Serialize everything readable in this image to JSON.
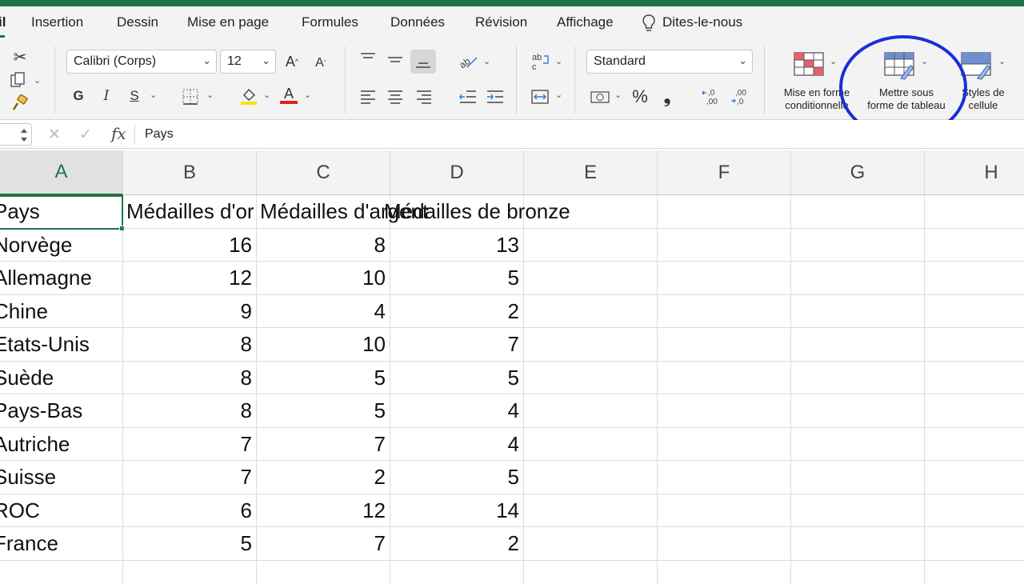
{
  "tabs": [
    "il",
    "Insertion",
    "Dessin",
    "Mise en page",
    "Formules",
    "Données",
    "Révision",
    "Affichage",
    "Dites-le-nous"
  ],
  "ribbon": {
    "font_name": "Calibri (Corps)",
    "font_size": "12",
    "bold": "G",
    "italic": "I",
    "underline": "S",
    "number_format": "Standard",
    "percent": "%",
    "comma": "❟",
    "cond_format_l1": "Mise en forme",
    "cond_format_l2": "conditionnelle",
    "format_table_l1": "Mettre sous",
    "format_table_l2": "forme de tableau",
    "cell_styles_l1": "Styles de",
    "cell_styles_l2": "cellule"
  },
  "formula_bar": {
    "fx": "fx",
    "value": "Pays"
  },
  "columns": [
    "A",
    "B",
    "C",
    "D",
    "E",
    "F",
    "G",
    "H"
  ],
  "rows": [
    [
      "Pays",
      "Médailles d'or",
      "Médailles d'argent",
      "Médailles de bronze"
    ],
    [
      "Norvège",
      "16",
      "8",
      "13"
    ],
    [
      "Allemagne",
      "12",
      "10",
      "5"
    ],
    [
      "Chine",
      "9",
      "4",
      "2"
    ],
    [
      "Etats-Unis",
      "8",
      "10",
      "7"
    ],
    [
      "Suède",
      "8",
      "5",
      "5"
    ],
    [
      "Pays-Bas",
      "8",
      "5",
      "4"
    ],
    [
      "Autriche",
      "7",
      "7",
      "4"
    ],
    [
      "Suisse",
      "7",
      "2",
      "5"
    ],
    [
      "ROC",
      "6",
      "12",
      "14"
    ],
    [
      "France",
      "5",
      "7",
      "2"
    ]
  ],
  "accent_color": "#217346",
  "annotation_color": "#1a2fd6"
}
